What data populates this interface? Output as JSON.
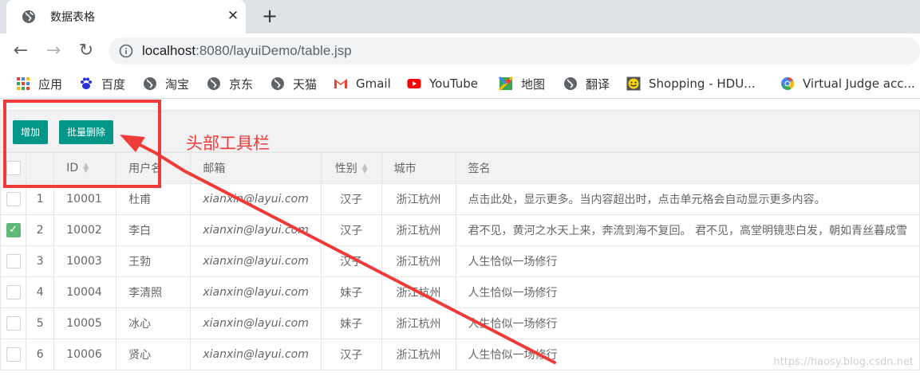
{
  "browser": {
    "tab_title": "数据表格",
    "tab_close": "✕",
    "new_tab": "+",
    "url_host": "localhost",
    "url_rest": ":8080/layuiDemo/table.jsp",
    "bookmarks": [
      {
        "label": "应用",
        "icon": "apps-grid-icon"
      },
      {
        "label": "百度",
        "icon": "baidu-paw-icon"
      },
      {
        "label": "淘宝",
        "icon": "globe-icon"
      },
      {
        "label": "京东",
        "icon": "globe-icon"
      },
      {
        "label": "天猫",
        "icon": "globe-icon"
      },
      {
        "label": "Gmail",
        "icon": "gmail-icon"
      },
      {
        "label": "YouTube",
        "icon": "youtube-icon"
      },
      {
        "label": "地图",
        "icon": "maps-icon"
      },
      {
        "label": "翻译",
        "icon": "globe-icon"
      },
      {
        "label": "Shopping - HDU...",
        "icon": "smiley-icon"
      },
      {
        "label": "Virtual Judge acc...",
        "icon": "vjudge-icon"
      }
    ]
  },
  "toolbar": {
    "add_label": "增加",
    "batch_delete_label": "批量删除",
    "annotation": "头部工具栏"
  },
  "table": {
    "columns": [
      "ID",
      "用户名",
      "邮箱",
      "性别",
      "城市",
      "签名"
    ],
    "rows": [
      {
        "idx": "1",
        "id": "10001",
        "name": "杜甫",
        "email": "xianxin@layui.com",
        "sex": "汉子",
        "city": "浙江杭州",
        "sign": "点击此处，显示更多。当内容超出时，点击单元格会自动显示更多内容。",
        "checked": false
      },
      {
        "idx": "2",
        "id": "10002",
        "name": "李白",
        "email": "xianxin@layui.com",
        "sex": "汉子",
        "city": "浙江杭州",
        "sign": "君不见，黄河之水天上来，奔流到海不复回。 君不见，高堂明镜悲白发，朝如青丝暮成雪",
        "checked": true
      },
      {
        "idx": "3",
        "id": "10003",
        "name": "王勃",
        "email": "xianxin@layui.com",
        "sex": "汉子",
        "city": "浙江杭州",
        "sign": "人生恰似一场修行",
        "checked": false
      },
      {
        "idx": "4",
        "id": "10004",
        "name": "李清照",
        "email": "xianxin@layui.com",
        "sex": "妹子",
        "city": "浙江杭州",
        "sign": "人生恰似一场修行",
        "checked": false
      },
      {
        "idx": "5",
        "id": "10005",
        "name": "冰心",
        "email": "xianxin@layui.com",
        "sex": "妹子",
        "city": "浙江杭州",
        "sign": "人生恰似一场修行",
        "checked": false
      },
      {
        "idx": "6",
        "id": "10006",
        "name": "贤心",
        "email": "xianxin@layui.com",
        "sex": "汉子",
        "city": "浙江杭州",
        "sign": "人生恰似一场修行",
        "checked": false
      }
    ]
  },
  "watermark": "https://haosy.blog.csdn.net",
  "colors": {
    "accent": "#009688",
    "annotation": "#f03b3b",
    "checked": "#5fb878"
  }
}
